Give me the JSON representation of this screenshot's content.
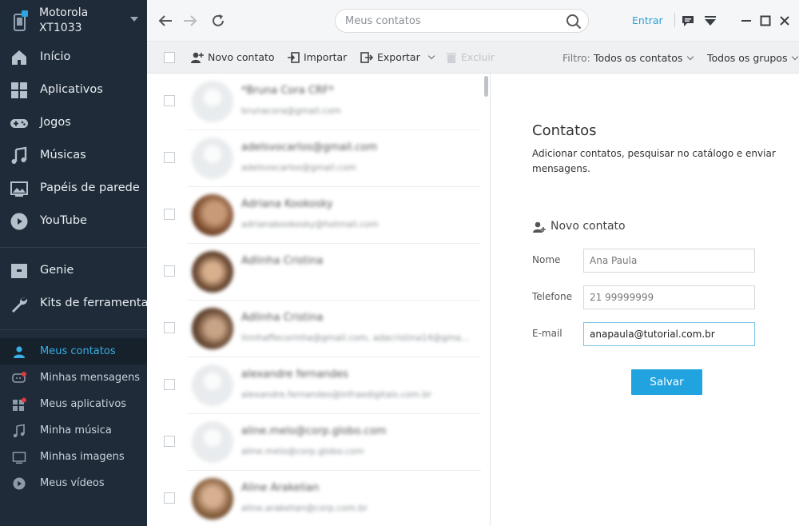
{
  "device": {
    "name": "Motorola XT1033"
  },
  "nav": [
    {
      "label": "Início",
      "icon": "home-icon"
    },
    {
      "label": "Aplicativos",
      "icon": "apps-icon"
    },
    {
      "label": "Jogos",
      "icon": "gamepad-icon"
    },
    {
      "label": "Músicas",
      "icon": "music-icon"
    },
    {
      "label": "Papéis de parede",
      "icon": "wallpaper-icon"
    },
    {
      "label": "YouTube",
      "icon": "youtube-icon"
    },
    {
      "label": "Genie",
      "icon": "genie-icon"
    },
    {
      "label": "Kits de ferramentas",
      "icon": "wrench-icon"
    }
  ],
  "sub_nav": [
    {
      "label": "Meus contatos",
      "icon": "person-icon",
      "active": true
    },
    {
      "label": "Minhas mensagens",
      "icon": "message-icon"
    },
    {
      "label": "Meus aplicativos",
      "icon": "apps-icon"
    },
    {
      "label": "Minha música",
      "icon": "music-note-icon"
    },
    {
      "label": "Minhas imagens",
      "icon": "image-icon"
    },
    {
      "label": "Meus vídeos",
      "icon": "play-icon"
    }
  ],
  "topbar": {
    "search_placeholder": "Meus contatos",
    "login_label": "Entrar"
  },
  "toolbar": {
    "new_contact": "Novo contato",
    "import": "Importar",
    "export": "Exportar",
    "delete": "Excluir",
    "filter_label": "Filtro:",
    "filter_value": "Todos os contatos",
    "groups_value": "Todos os grupos"
  },
  "contacts": [
    {
      "name": "*Bruna Cora CRF*",
      "email": "brunacora@gmail.com",
      "photo": false
    },
    {
      "name": "adelsvocarlos@gmail.com",
      "email": "adelsvocarlos@gmail.com",
      "photo": false
    },
    {
      "name": "Adriana Kookosky",
      "email": "adrianakookosky@hotmail.com",
      "photo": true
    },
    {
      "name": "Adlinha Cristina",
      "email": "",
      "photo": true
    },
    {
      "name": "Adlinha Cristina",
      "email": "linnhaffecorinha@gmail.com, adacristina14@gma...",
      "photo": true
    },
    {
      "name": "alexandre fernandes",
      "email": "alexandre.fernandes@infraedigitais.com.br",
      "photo": false
    },
    {
      "name": "aline.melo@corp.globo.com",
      "email": "aline.melo@corp.globo.com",
      "photo": false
    },
    {
      "name": "Aline Arakelian",
      "email": "aline.arakelian@corp.com.br",
      "photo": true
    }
  ],
  "panel": {
    "title": "Contatos",
    "description": "Adicionar contatos, pesquisar no catálogo e enviar mensagens.",
    "new_contact_heading": "Novo contato",
    "fields": {
      "name_label": "Nome",
      "name_value": "Ana Paula",
      "phone_label": "Telefone",
      "phone_value": "21 99999999",
      "email_label": "E-mail",
      "email_value": "anapaula@tutorial.com.br"
    },
    "save_label": "Salvar"
  },
  "colors": {
    "sidebar_bg": "#1f2b38",
    "accent": "#21a3e0",
    "active_text": "#3aaee6"
  }
}
